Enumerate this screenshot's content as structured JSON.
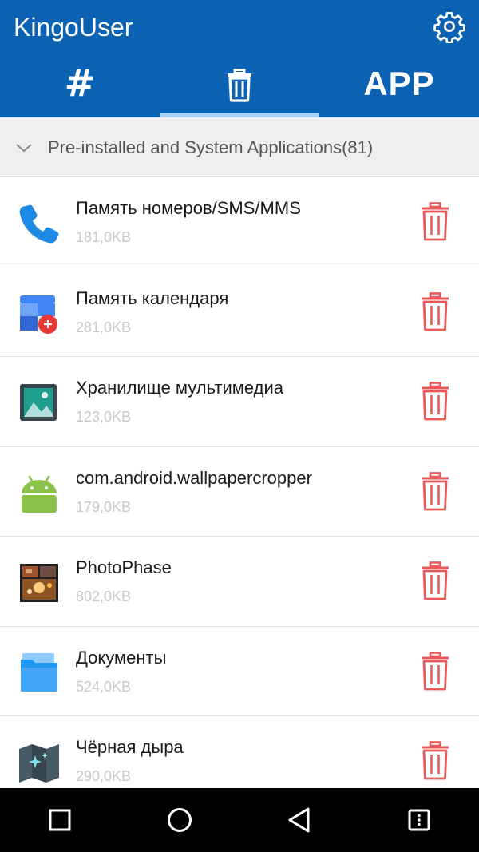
{
  "app": {
    "title": "KingoUser"
  },
  "header": {
    "settings_icon": "gear-icon",
    "tabs": [
      {
        "label": "#",
        "icon": "hash-icon",
        "selected": false
      },
      {
        "label": "",
        "icon": "trash-icon",
        "selected": true
      },
      {
        "label": "APP",
        "icon": "",
        "selected": false
      }
    ]
  },
  "section": {
    "title": "Pre-installed and System Applications(81)",
    "icon": "chevron-down-icon"
  },
  "apps": [
    {
      "name": "Память номеров/SMS/MMS",
      "size": "181,0KB",
      "icon": "phone-icon"
    },
    {
      "name": "Память календаря",
      "size": "281,0KB",
      "icon": "calendar-icon"
    },
    {
      "name": "Хранилище мультимедиа",
      "size": "123,0KB",
      "icon": "media-storage-icon"
    },
    {
      "name": "com.android.wallpapercropper",
      "size": "179,0KB",
      "icon": "android-icon"
    },
    {
      "name": "PhotoPhase",
      "size": "802,0KB",
      "icon": "photophase-icon"
    },
    {
      "name": "Документы",
      "size": "524,0KB",
      "icon": "folder-icon"
    },
    {
      "name": "Чёрная дыра",
      "size": "290,0KB",
      "icon": "map-icon"
    }
  ],
  "navbar": {
    "buttons": [
      "square-icon",
      "circle-icon",
      "back-triangle-icon",
      "menu-icon"
    ]
  },
  "colors": {
    "header": "#0b62b3",
    "tab_indicator": "#a9d3ff",
    "delete_red": "#e85a5a",
    "section_bg": "#efefef"
  }
}
